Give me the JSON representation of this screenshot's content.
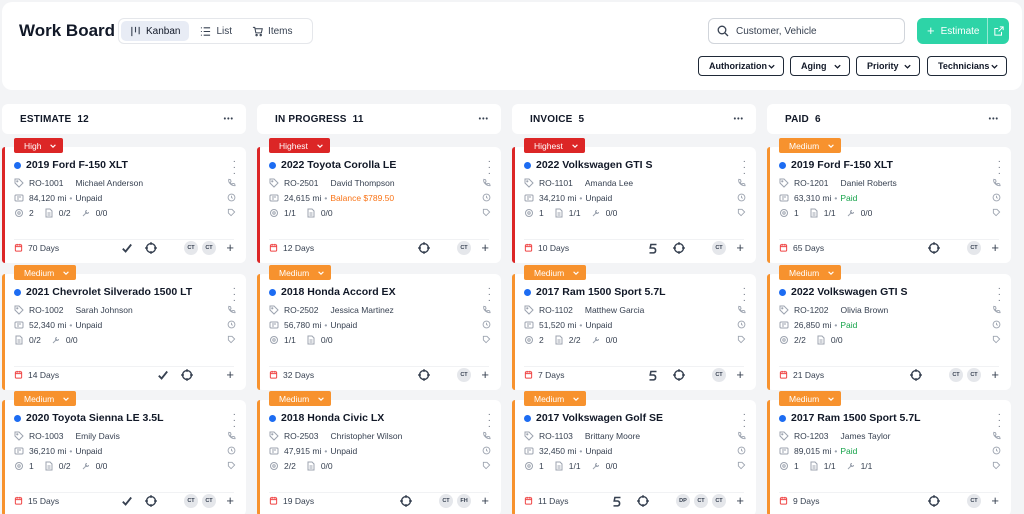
{
  "header": {
    "title": "Work Board",
    "view_tabs": [
      {
        "label": "Kanban",
        "icon": "kanban-icon",
        "active": true
      },
      {
        "label": "List",
        "icon": "list-icon",
        "active": false
      },
      {
        "label": "Items",
        "icon": "cart-icon",
        "active": false
      }
    ],
    "search_placeholder": "Customer, Vehicle",
    "estimate_label": "Estimate",
    "filters": [
      "Authorization",
      "Aging",
      "Priority",
      "Technicians"
    ]
  },
  "colors": {
    "accent": "#2dd4a7",
    "high": "#dc2626",
    "medium": "#f7922e",
    "vehicle_dot": "#1d6cf2"
  },
  "columns": [
    {
      "name": "ESTIMATE",
      "count": "12",
      "cards": [
        {
          "priority": "High",
          "vehicle": "2019 Ford F-150 XLT",
          "ro": "RO-1001",
          "customer": "Michael Anderson",
          "mileage": "84,120 mi",
          "status": "Unpaid",
          "stat_a": "2",
          "stat_b": "0/2",
          "stat_c": "0/0",
          "days": "70 Days",
          "techs": [
            "CT",
            "CT"
          ],
          "check": true,
          "s_icon": false
        },
        {
          "priority": "Medium",
          "vehicle": "2021 Chevrolet Silverado 1500 LT",
          "ro": "RO-1002",
          "customer": "Sarah Johnson",
          "mileage": "52,340 mi",
          "status": "Unpaid",
          "stat_a": "",
          "stat_b": "0/2",
          "stat_c": "0/0",
          "days": "14 Days",
          "techs": [],
          "check": true,
          "s_icon": false
        },
        {
          "priority": "Medium",
          "vehicle": "2020 Toyota Sienna LE 3.5L",
          "ro": "RO-1003",
          "customer": "Emily Davis",
          "mileage": "36,210 mi",
          "status": "Unpaid",
          "stat_a": "1",
          "stat_b": "0/2",
          "stat_c": "0/0",
          "days": "15 Days",
          "techs": [
            "CT",
            "CT"
          ],
          "check": true,
          "s_icon": false
        }
      ]
    },
    {
      "name": "IN PROGRESS",
      "count": "11",
      "cards": [
        {
          "priority": "Highest",
          "vehicle": "2022 Toyota Corolla LE",
          "ro": "RO-2501",
          "customer": "David Thompson",
          "mileage": "24,615 mi",
          "status": "Balance $789.50",
          "stat_a": "1/1",
          "stat_b": "0/0",
          "stat_c": "",
          "days": "12 Days",
          "techs": [
            "CT"
          ],
          "check": false,
          "s_icon": false
        },
        {
          "priority": "Medium",
          "vehicle": "2018 Honda Accord EX",
          "ro": "RO-2502",
          "customer": "Jessica Martinez",
          "mileage": "56,780 mi",
          "status": "Unpaid",
          "stat_a": "1/1",
          "stat_b": "0/0",
          "stat_c": "",
          "days": "32 Days",
          "techs": [
            "CT"
          ],
          "check": false,
          "s_icon": false
        },
        {
          "priority": "Medium",
          "vehicle": "2018 Honda Civic LX",
          "ro": "RO-2503",
          "customer": "Christopher Wilson",
          "mileage": "47,915 mi",
          "status": "Unpaid",
          "stat_a": "2/2",
          "stat_b": "0/0",
          "stat_c": "",
          "days": "19 Days",
          "techs": [
            "CT",
            "FH"
          ],
          "check": false,
          "s_icon": false
        }
      ]
    },
    {
      "name": "INVOICE",
      "count": "5",
      "cards": [
        {
          "priority": "Highest",
          "vehicle": "2022 Volkswagen GTI S",
          "ro": "RO-1101",
          "customer": "Amanda Lee",
          "mileage": "34,210 mi",
          "status": "Unpaid",
          "stat_a": "1",
          "stat_b": "1/1",
          "stat_c": "0/0",
          "days": "10 Days",
          "techs": [
            "CT"
          ],
          "check": false,
          "s_icon": true
        },
        {
          "priority": "Medium",
          "vehicle": "2017 Ram 1500 Sport 5.7L",
          "ro": "RO-1102",
          "customer": "Matthew Garcia",
          "mileage": "51,520 mi",
          "status": "Unpaid",
          "stat_a": "2",
          "stat_b": "2/2",
          "stat_c": "0/0",
          "days": "7 Days",
          "techs": [
            "CT"
          ],
          "check": false,
          "s_icon": true
        },
        {
          "priority": "Medium",
          "vehicle": "2017 Volkswagen Golf SE",
          "ro": "RO-1103",
          "customer": "Brittany Moore",
          "mileage": "32,450 mi",
          "status": "Unpaid",
          "stat_a": "1",
          "stat_b": "1/1",
          "stat_c": "0/0",
          "days": "11 Days",
          "techs": [
            "DP",
            "CT",
            "CT"
          ],
          "check": false,
          "s_icon": true
        }
      ]
    },
    {
      "name": "PAID",
      "count": "6",
      "cards": [
        {
          "priority": "Medium",
          "vehicle": "2019 Ford F-150 XLT",
          "ro": "RO-1201",
          "customer": "Daniel Roberts",
          "mileage": "63,310 mi",
          "status": "Paid",
          "stat_a": "1",
          "stat_b": "1/1",
          "stat_c": "0/0",
          "days": "65 Days",
          "techs": [
            "CT"
          ],
          "check": false,
          "s_icon": false
        },
        {
          "priority": "Medium",
          "vehicle": "2022 Volkswagen GTI S",
          "ro": "RO-1202",
          "customer": "Olivia Brown",
          "mileage": "26,850 mi",
          "status": "Paid",
          "stat_a": "2/2",
          "stat_b": "0/0",
          "stat_c": "",
          "days": "21 Days",
          "techs": [
            "CT",
            "CT"
          ],
          "check": false,
          "s_icon": false
        },
        {
          "priority": "Medium",
          "vehicle": "2017 Ram 1500 Sport 5.7L",
          "ro": "RO-1203",
          "customer": "James Taylor",
          "mileage": "89,015 mi",
          "status": "Paid",
          "stat_a": "1",
          "stat_b": "1/1",
          "stat_c": "1/1",
          "days": "9 Days",
          "techs": [
            "CT"
          ],
          "check": false,
          "s_icon": false
        }
      ]
    }
  ]
}
